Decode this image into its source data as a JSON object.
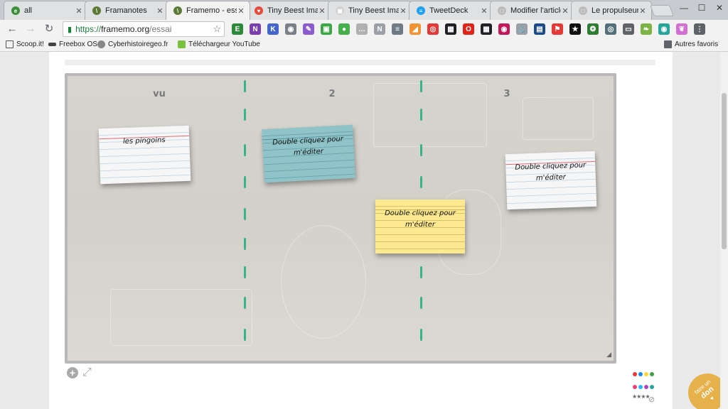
{
  "tabs": [
    {
      "title": "all",
      "color": "#3b8f3b",
      "letter": "e"
    },
    {
      "title": "Framanotes",
      "color": "#5a7a35",
      "letter": "\\"
    },
    {
      "title": "Framemo - essai",
      "color": "#5a7a35",
      "letter": "\\"
    },
    {
      "title": "Tiny Beest Imag",
      "color": "#e64a3b",
      "letter": "♥"
    },
    {
      "title": "Tiny Beest Imag",
      "color": "#d0d0d0",
      "letter": "▣"
    },
    {
      "title": "TweetDeck",
      "color": "#1da1f2",
      "letter": "≡"
    },
    {
      "title": "Modifier l'article",
      "color": "#bbbbbb",
      "letter": "□"
    },
    {
      "title": "Le propulseur d",
      "color": "#bbbbbb",
      "letter": "□"
    }
  ],
  "window_controls": {
    "minimize": "—",
    "maximize": "☐",
    "close": "✕"
  },
  "nav": {
    "back": "←",
    "forward": "→",
    "reload": "↻"
  },
  "omnibox": {
    "lock": "🔒",
    "protocol": "https://",
    "host": "framemo.org",
    "path": "/essai",
    "star": "☆"
  },
  "extensions": [
    {
      "name": "evernote-icon",
      "color": "#2d8a3a",
      "glyph": "E"
    },
    {
      "name": "onenote-icon",
      "color": "#7b3fb0",
      "glyph": "N"
    },
    {
      "name": "klout-icon",
      "color": "#4466cc",
      "glyph": "K"
    },
    {
      "name": "camera-icon",
      "color": "#7a8088",
      "glyph": "◉"
    },
    {
      "name": "pen-icon",
      "color": "#8b5ccf",
      "glyph": "✎"
    },
    {
      "name": "feedly-icon",
      "color": "#3aa845",
      "glyph": "▣"
    },
    {
      "name": "green-dot-icon",
      "color": "#45b04a",
      "glyph": "●"
    },
    {
      "name": "share-icon",
      "color": "#b0b0b0",
      "glyph": "…"
    },
    {
      "name": "newsfeed-icon",
      "color": "#9aa0a6",
      "glyph": "N"
    },
    {
      "name": "stack-icon",
      "color": "#6f7a84",
      "glyph": "≡"
    },
    {
      "name": "rss-icon",
      "color": "#f09433",
      "glyph": "◢"
    },
    {
      "name": "podcast-icon",
      "color": "#e53935",
      "glyph": "◎"
    },
    {
      "name": "qrcode-icon",
      "color": "#202124",
      "glyph": "▦"
    },
    {
      "name": "opera-icon",
      "color": "#e2231a",
      "glyph": "O"
    },
    {
      "name": "qrcode2-icon",
      "color": "#202124",
      "glyph": "▦"
    },
    {
      "name": "record-icon",
      "color": "#c2185b",
      "glyph": "◉"
    },
    {
      "name": "anchor-icon",
      "color": "#9aa0a6",
      "glyph": "⚓"
    },
    {
      "name": "reader-icon",
      "color": "#1a4b8c",
      "glyph": "▤"
    },
    {
      "name": "flag-icon",
      "color": "#e53935",
      "glyph": "⚑"
    },
    {
      "name": "star-ext-icon",
      "color": "#111111",
      "glyph": "★"
    },
    {
      "name": "turtle-icon",
      "color": "#2e7d32",
      "glyph": "❂"
    },
    {
      "name": "bullseye-icon",
      "color": "#546e7a",
      "glyph": "◎"
    },
    {
      "name": "cast-icon",
      "color": "#5f6368",
      "glyph": "▭"
    },
    {
      "name": "leaf-icon",
      "color": "#7cb342",
      "glyph": "❧"
    },
    {
      "name": "eye-icon",
      "color": "#26a69a",
      "glyph": "◉"
    },
    {
      "name": "elephant-icon",
      "color": "#d36fd3",
      "glyph": "❦"
    },
    {
      "name": "menu-icon",
      "color": "#5f6368",
      "glyph": "⋮"
    }
  ],
  "bookmarks": [
    {
      "label": "Scoop.it!",
      "color": "#2b2b2b"
    },
    {
      "label": "Freebox OS",
      "color": "#444444"
    },
    {
      "label": "Cyberhistoiregeo.fr",
      "color": "#666666"
    },
    {
      "label": "Téléchargeur YouTube",
      "color": "#7ac142"
    }
  ],
  "other_bookmarks": "Autres favoris",
  "columns": [
    "vu",
    "2",
    "3"
  ],
  "cards": [
    {
      "text": "les pingoins",
      "color": "white"
    },
    {
      "text": "Double cliquez pour m'éditer",
      "color": "blue"
    },
    {
      "text": "Double cliquez pour m'éditer",
      "color": "yellow"
    },
    {
      "text": "Double cliquez pour m'éditer",
      "color": "white"
    }
  ],
  "board_tools": {
    "add": "+",
    "fullscreen": "⤢",
    "resize": "◢"
  },
  "palette_colors": [
    "#e53935",
    "#1e88e5",
    "#fdd835",
    "#43a047",
    "#ec407a",
    "#29b6f6",
    "#ab47bc",
    "#26a69a"
  ],
  "palette_stars": "★★★★",
  "block_icon": "⊘",
  "donate": {
    "line1": "faire un",
    "line2": "don",
    "heart": "♥"
  }
}
